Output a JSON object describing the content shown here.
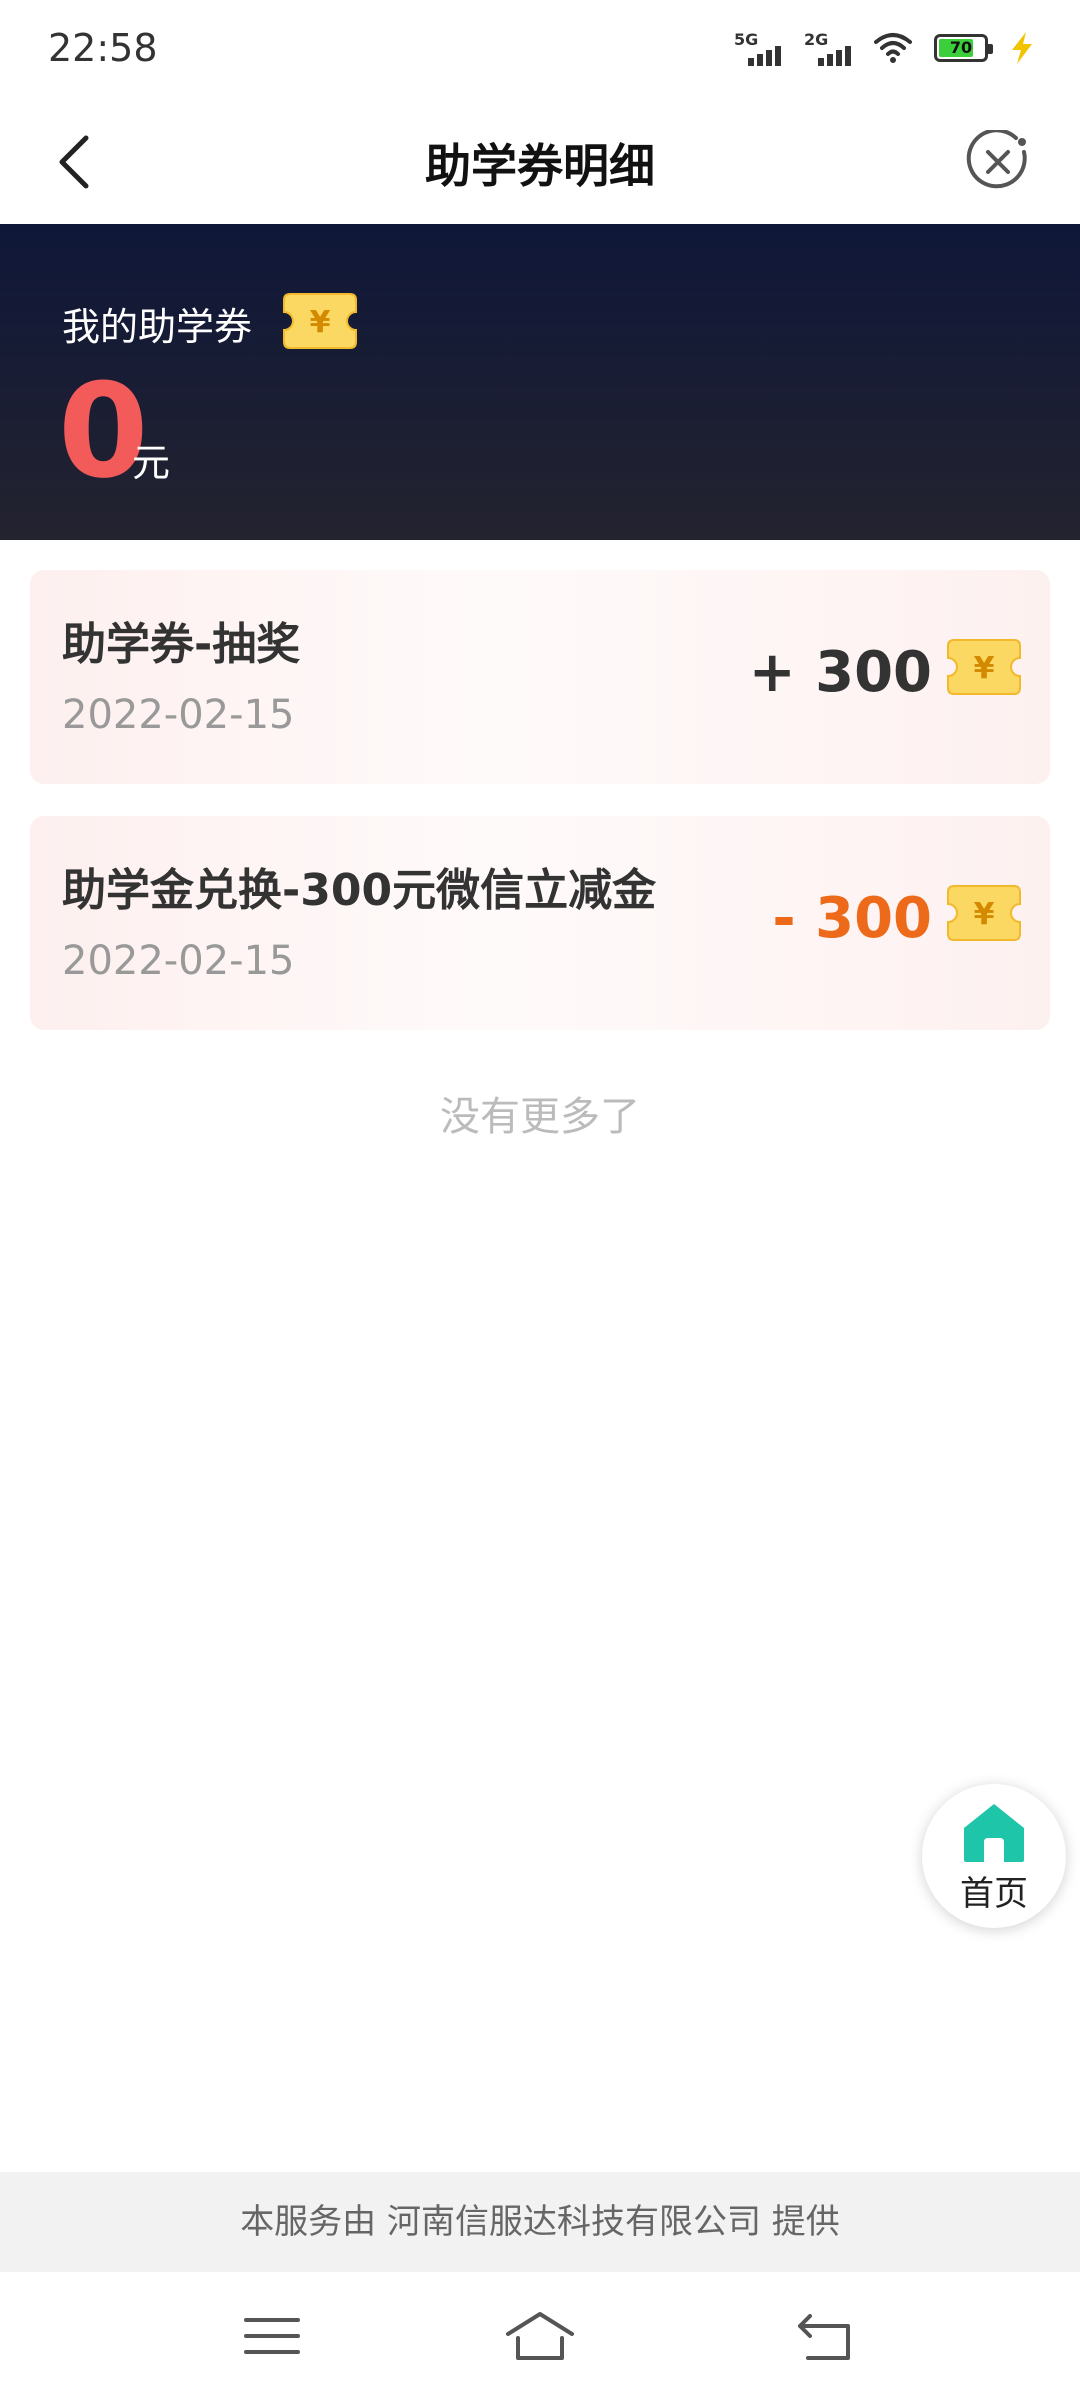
{
  "status_bar": {
    "time": "22:58",
    "network1": "5G",
    "network2": "2G",
    "battery_level": "70",
    "icons": [
      "signal-5g-icon",
      "signal-2g-icon",
      "wifi-icon",
      "battery-icon",
      "charging-icon"
    ]
  },
  "nav": {
    "title": "助学券明细",
    "back_icon": "chevron-left-icon",
    "close_icon": "close-circle-icon"
  },
  "banner": {
    "label": "我的助学券",
    "balance": "0",
    "unit": "元",
    "ticket_icon": "yuan-ticket-icon"
  },
  "records": [
    {
      "title": "助学券-抽奖",
      "date": "2022-02-15",
      "amount": "+ 300"
    },
    {
      "title": "助学金兑换-300元微信立减金",
      "date": "2022-02-15",
      "amount": "- 300"
    }
  ],
  "list_end_text": "没有更多了",
  "home_button": {
    "label": "首页",
    "icon": "home-icon"
  },
  "footer_text": "本服务由 河南信服达科技有限公司 提供",
  "colors": {
    "balance": "#f35b5b",
    "minus_amount": "#ed6a1a",
    "banner_bg": "#0f1739",
    "home_icon": "#1fc5a9",
    "ticket": "#fbd862"
  },
  "system_nav_icons": [
    "menu-icon",
    "home-outline-icon",
    "back-return-icon"
  ]
}
